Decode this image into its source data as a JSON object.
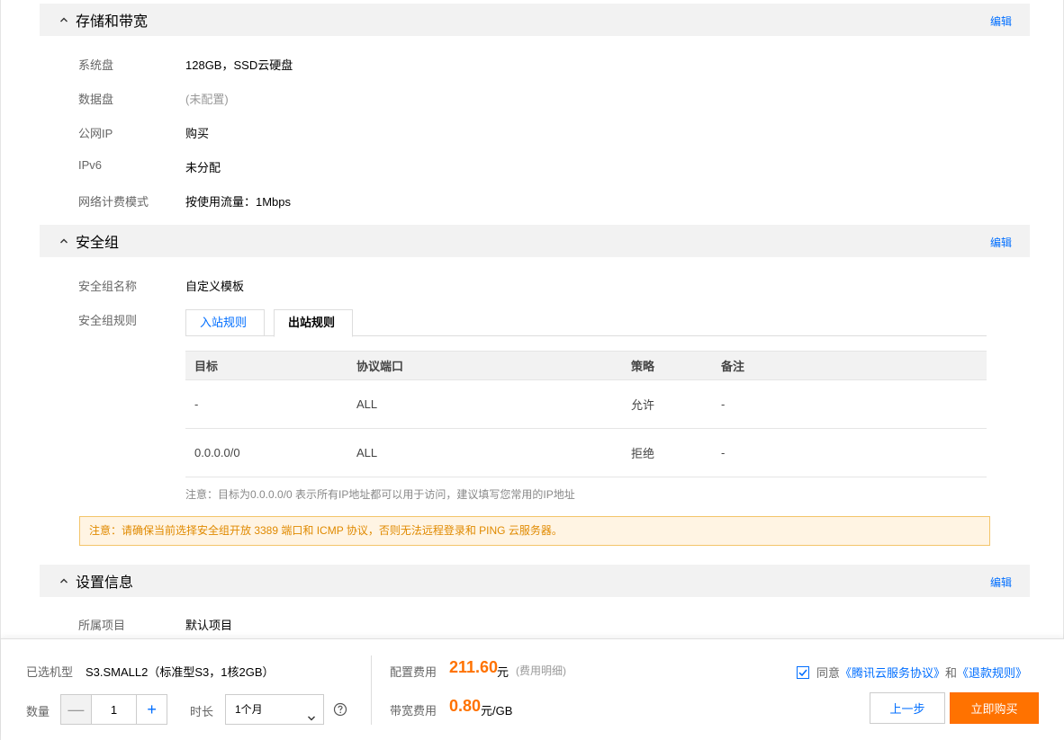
{
  "storage": {
    "title": "存储和带宽",
    "edit": "编辑",
    "rows": [
      {
        "k": "系统盘",
        "v": "128GB，SSD云硬盘"
      },
      {
        "k": "数据盘",
        "v": "(未配置)"
      },
      {
        "k": "公网IP",
        "v": "购买"
      },
      {
        "k": "IPv6",
        "v": "未分配"
      },
      {
        "k": "网络计费模式",
        "v": "按使用流量：1Mbps"
      }
    ]
  },
  "security": {
    "title": "安全组",
    "edit": "编辑",
    "name_label": "安全组名称",
    "name_value": "自定义模板",
    "rules_label": "安全组规则",
    "tabs": [
      "入站规则",
      "出站规则"
    ],
    "table": {
      "headers": [
        "目标",
        "协议端口",
        "策略",
        "备注"
      ],
      "rows": [
        [
          "-",
          "ALL",
          "允许",
          "-"
        ],
        [
          "0.0.0.0/0",
          "ALL",
          "拒绝",
          "-"
        ]
      ]
    },
    "note": "注意：目标为0.0.0.0/0 表示所有IP地址都可以用于访问，建议填写您常用的IP地址",
    "warning": "注意：请确保当前选择安全组开放 3389 端口和 ICMP 协议，否则无法远程登录和 PING 云服务器。"
  },
  "settings": {
    "title": "设置信息",
    "edit": "编辑",
    "project_label": "所属项目",
    "project_value": "默认项目"
  },
  "footer": {
    "selected_label": "已选机型",
    "selected_value": "S3.SMALL2（标准型S3，1核2GB）",
    "qty_label": "数量",
    "qty_dec": "—",
    "qty_value": "1",
    "qty_inc": "+",
    "duration_label": "时长",
    "duration_value": "1个月",
    "config_fee_label": "配置费用",
    "config_fee_price": "211.60",
    "config_fee_unit": "元",
    "config_fee_detail": "(费用明细)",
    "bw_fee_label": "带宽费用",
    "bw_fee_price": "0.80",
    "bw_fee_unit": "元/GB",
    "agree_prefix": "同意",
    "agree_link1": "《腾讯云服务协议》",
    "agree_and": "和",
    "agree_link2": "《退款规则》",
    "prev_button": "上一步",
    "buy_button": "立即购买"
  },
  "colors": {
    "accent": "#006eff",
    "price": "#ff7200",
    "buy_button": "#ff7200",
    "warning_bg": "#fff4e3",
    "warning_text": "#e08a00"
  },
  "icons": [
    "chevron-up-icon",
    "chevron-down-icon",
    "help-circle-icon",
    "checkbox-checked-icon"
  ]
}
